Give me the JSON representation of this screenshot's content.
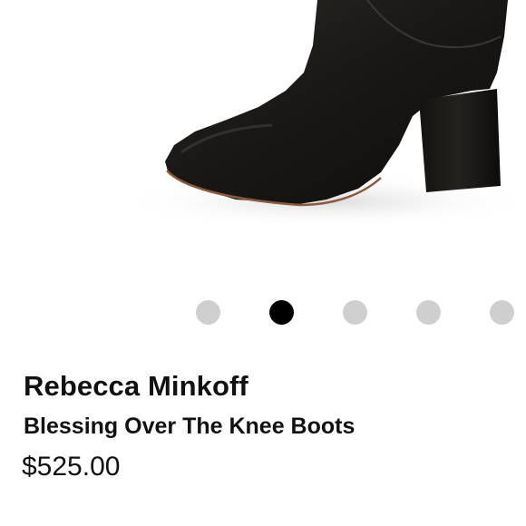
{
  "product": {
    "image_alt": "black leather over the knee boot",
    "brand": "Rebecca Minkoff",
    "name": "Blessing Over The Knee Boots",
    "price": "$525.00"
  },
  "carousel": {
    "total": 5,
    "active_index": 1,
    "dot_color": "#cfcfcf",
    "active_color": "#000000"
  }
}
